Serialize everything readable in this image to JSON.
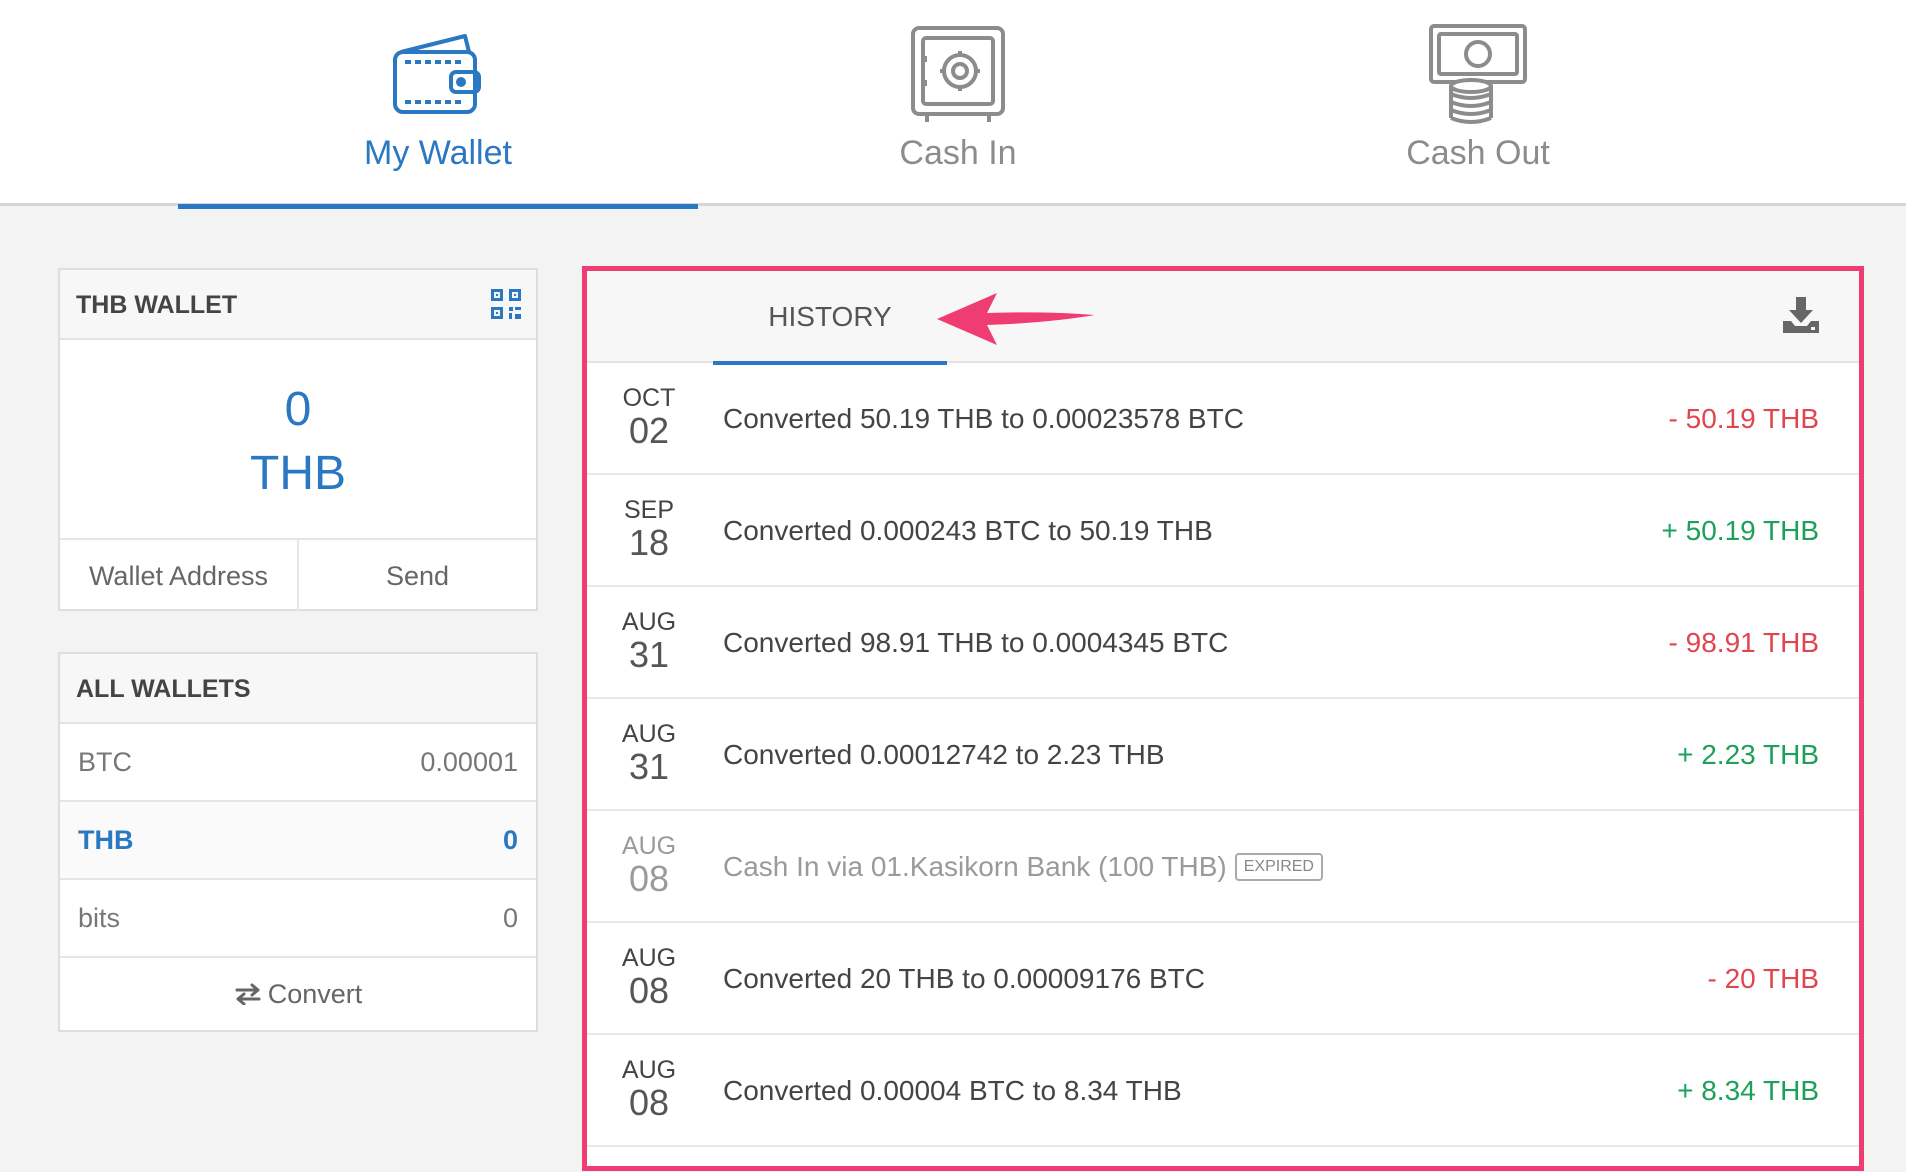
{
  "nav": {
    "tabs": [
      {
        "label": "My Wallet",
        "icon": "wallet-icon",
        "active": true
      },
      {
        "label": "Cash In",
        "icon": "safe-icon",
        "active": false
      },
      {
        "label": "Cash Out",
        "icon": "cash-coins-icon",
        "active": false
      }
    ]
  },
  "thb_wallet": {
    "title": "THB WALLET",
    "balance_amount": "0",
    "balance_currency": "THB",
    "actions": [
      "Wallet Address",
      "Send"
    ]
  },
  "all_wallets": {
    "title": "ALL WALLETS",
    "items": [
      {
        "currency": "BTC",
        "amount": "0.00001",
        "active": false
      },
      {
        "currency": "THB",
        "amount": "0",
        "active": true
      },
      {
        "currency": "bits",
        "amount": "0",
        "active": false
      }
    ],
    "convert_label": "Convert"
  },
  "history": {
    "tab_label": "HISTORY",
    "rows": [
      {
        "month": "OCT",
        "day": "02",
        "desc": "Converted 50.19 THB to 0.00023578 BTC",
        "amount": "- 50.19 THB",
        "sign": "neg"
      },
      {
        "month": "SEP",
        "day": "18",
        "desc": "Converted 0.000243 BTC to 50.19 THB",
        "amount": "+ 50.19 THB",
        "sign": "pos"
      },
      {
        "month": "AUG",
        "day": "31",
        "desc": "Converted 98.91 THB to 0.0004345 BTC",
        "amount": "- 98.91 THB",
        "sign": "neg"
      },
      {
        "month": "AUG",
        "day": "31",
        "desc": "Converted 0.00012742 to 2.23 THB",
        "amount": "+ 2.23 THB",
        "sign": "pos"
      },
      {
        "month": "AUG",
        "day": "08",
        "desc": "Cash In via 01.Kasikorn Bank (100 THB)",
        "badge": "EXPIRED",
        "amount": "",
        "sign": "muted"
      },
      {
        "month": "AUG",
        "day": "08",
        "desc": "Converted 20 THB to 0.00009176 BTC",
        "amount": "- 20 THB",
        "sign": "neg"
      },
      {
        "month": "AUG",
        "day": "08",
        "desc": "Converted 0.00004 BTC to 8.34 THB",
        "amount": "+ 8.34 THB",
        "sign": "pos"
      }
    ]
  },
  "colors": {
    "accent": "#2b78c2",
    "negative": "#e0464f",
    "positive": "#1ea05a",
    "highlight": "#ef3d73"
  }
}
